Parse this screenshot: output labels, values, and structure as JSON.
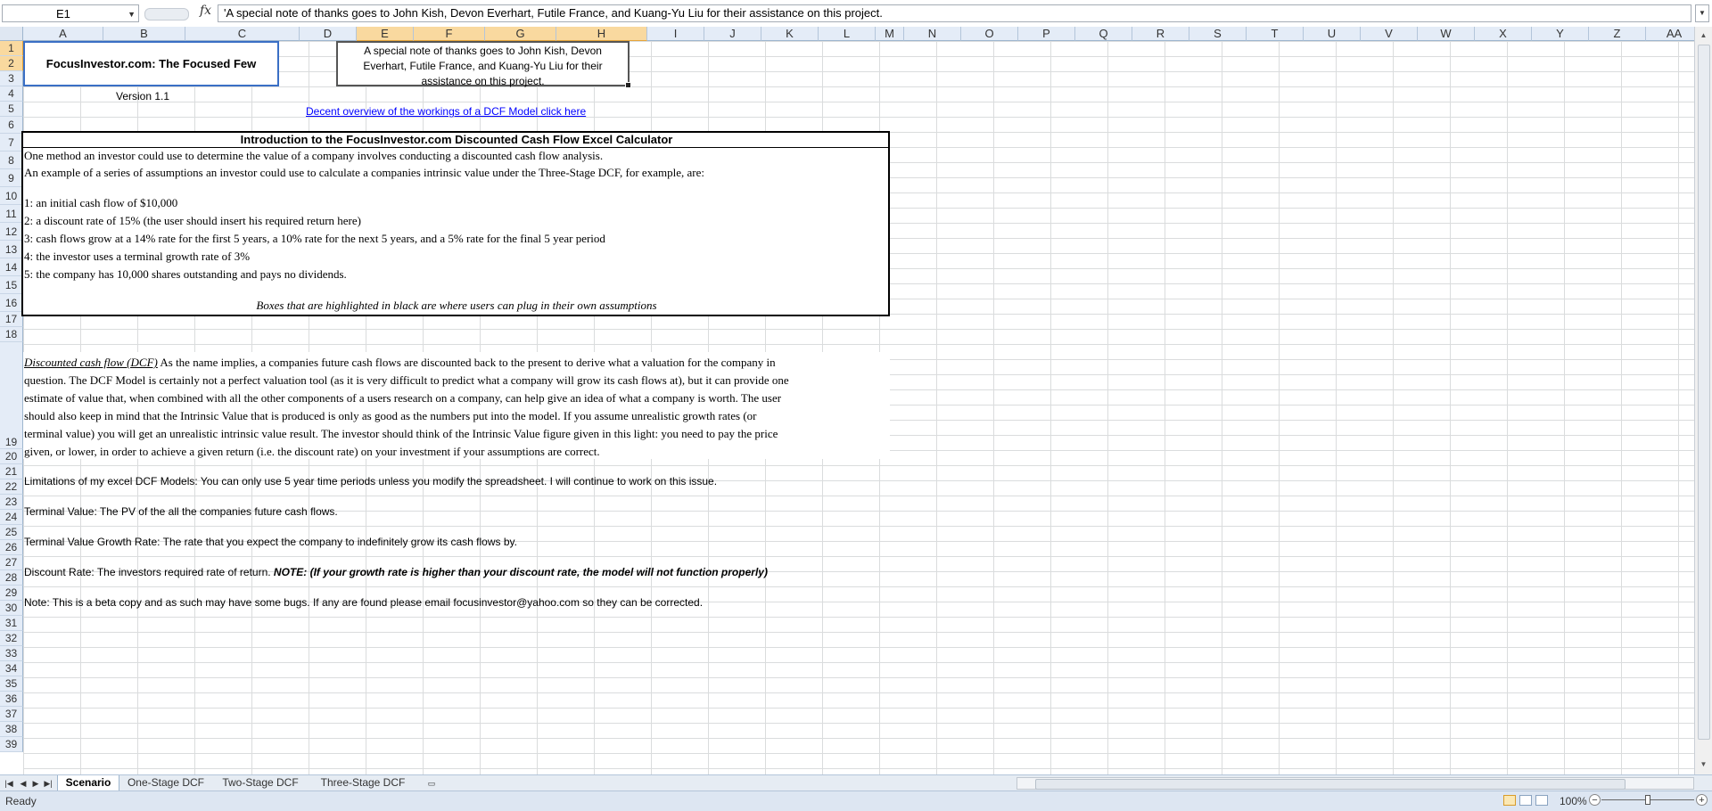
{
  "formula_bar": {
    "name_box": "E1",
    "fx": "fx",
    "content": "'A special note of thanks goes to John Kish, Devon Everhart, Futile France, and Kuang-Yu Liu  for their assistance on this project."
  },
  "columns": [
    "A",
    "B",
    "C",
    "D",
    "E",
    "F",
    "G",
    "H",
    "I",
    "J",
    "K",
    "L",
    "M",
    "N",
    "O",
    "P",
    "Q",
    "R",
    "S",
    "T",
    "U",
    "V",
    "W",
    "X",
    "Y",
    "Z",
    "AA"
  ],
  "rows": [
    "1",
    "2",
    "3",
    "4",
    "5",
    "6",
    "7",
    "8",
    "9",
    "10",
    "11",
    "12",
    "13",
    "14",
    "15",
    "16",
    "17",
    "18",
    "19",
    "20",
    "21",
    "22",
    "23",
    "24",
    "25",
    "26",
    "27",
    "28",
    "29",
    "30",
    "31",
    "32",
    "33",
    "34",
    "35",
    "36",
    "37",
    "38",
    "39"
  ],
  "cells": {
    "title_box": "FocusInvestor.com: The Focused Few",
    "thanks_line1": "A special note of thanks goes to John Kish, Devon",
    "thanks_line2": "Everhart, Futile France, and Kuang-Yu Liu  for their",
    "thanks_line3": "assistance on this project.",
    "version": "Version 1.1",
    "dcf_link": "Decent overview of the workings of a DCF Model click here",
    "intro_header": "Introduction to the FocusInvestor.com Discounted Cash Flow Excel Calculator",
    "r7": "One method an investor could use to determine the value of a company involves conducting a discounted cash flow analysis.",
    "r8": "An example of a series of assumptions an investor could use to calculate a companies intrinsic value under the Three-Stage DCF, for example, are:",
    "r10": "1: an initial cash flow of $10,000",
    "r11": "2: a discount rate of 15% (the user should insert his required return here)",
    "r12": "3: cash flows grow at a 14% rate for the first 5 years, a 10% rate for the next 5 years, and a 5% rate for the final 5 year period",
    "r13": "4: the investor uses a terminal growth rate of 3%",
    "r14": "5: the company has 10,000 shares outstanding and pays no dividends.",
    "r16": "Boxes that are highlighted in black are where users can plug in their own assumptions",
    "r19_lead": "Discounted cash flow (DCF)",
    "r19_l1": "  As the name implies, a companies future cash flows are discounted back to the present to derive what a valuation for the company in",
    "r19_l2": "question. The DCF Model is certainly not a perfect valuation tool (as it is very difficult to predict what a company will grow its cash flows at), but it can provide one",
    "r19_l3": "estimate of value that, when combined with all the other components of a users research on a company, can help give an idea of what a company is worth.  The user",
    "r19_l4": "should also keep in mind that the Intrinsic Value that is produced is only as good as the numbers put into the model.  If you assume unrealistic growth rates (or",
    "r19_l5": "terminal value) you will get an unrealistic intrinsic value result.  The investor should think of the Intrinsic Value figure given in this light:  you need to pay the price",
    "r19_l6": "given, or lower, in order to achieve a given return (i.e. the discount rate) on your investment if your assumptions are correct.",
    "r21": "Limitations of my excel DCF Models:  You can only use 5 year time periods unless you modify the spreadsheet.  I will continue to work on this issue.",
    "r23": "Terminal Value:  The PV of the all the companies future cash flows.",
    "r25": "Terminal Value Growth Rate:  The rate that you expect the company to indefinitely grow its cash flows by.",
    "r27_a": "Discount Rate:  The investors required rate of return.  ",
    "r27_b": "NOTE: (If your growth rate is higher than your discount rate, the model will not function properly)",
    "r29": "Note:  This is a beta copy and as such may have some bugs.  If any are found please email focusinvestor@yahoo.com so they can be corrected."
  },
  "sheet_tabs": [
    "Scenario",
    "One-Stage DCF",
    "Two-Stage DCF",
    "Three-Stage DCF"
  ],
  "active_tab": "Scenario",
  "status": {
    "ready": "Ready",
    "zoom": "100%",
    "zoom_level": 100
  },
  "colors": {
    "header_bg": "#e4ecf7",
    "selected_header": "#f9d99f",
    "link": "#0000ff",
    "gridline": "#dadcdd",
    "selection_border": "#3a6fc5"
  }
}
